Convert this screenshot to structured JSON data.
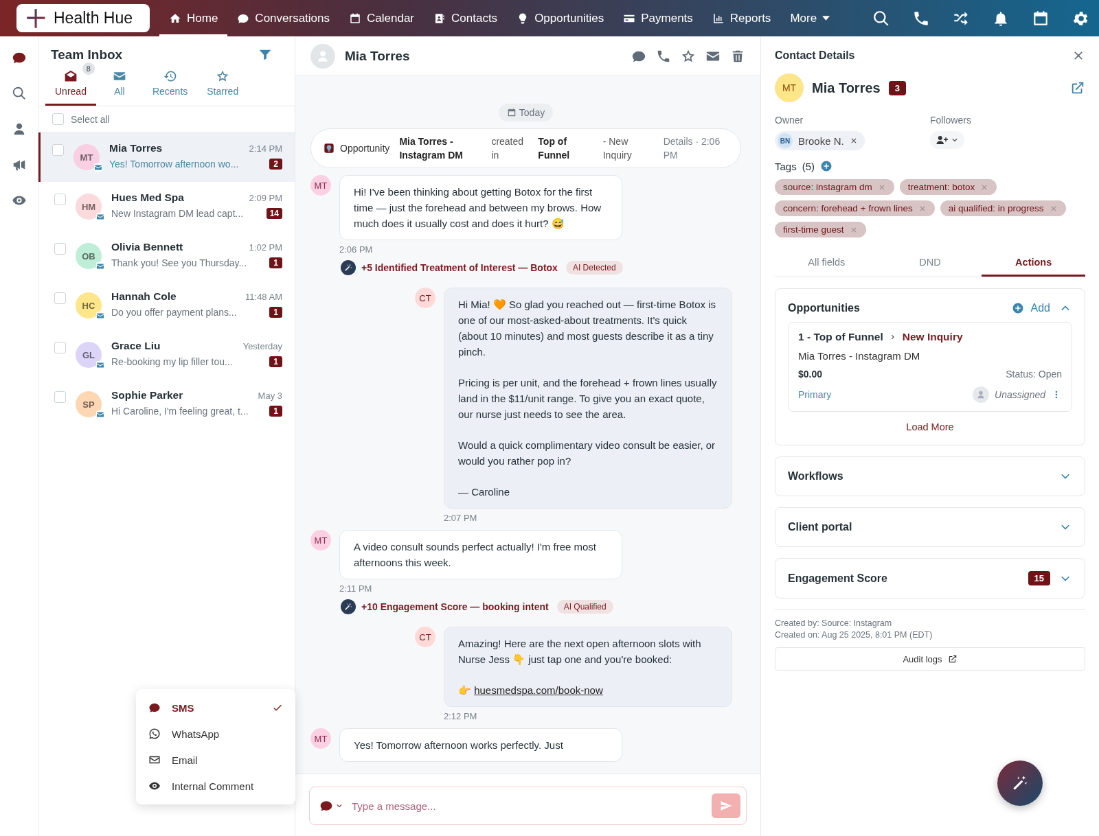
{
  "top_nav": {
    "logo": "Health Hue",
    "items": [
      {
        "label": "Home",
        "selected": true
      },
      {
        "label": "Conversations",
        "selected": false
      },
      {
        "label": "Calendar",
        "selected": false
      },
      {
        "label": "Contacts",
        "selected": false
      },
      {
        "label": "Opportunities",
        "selected": false
      },
      {
        "label": "Payments",
        "selected": false
      },
      {
        "label": "Reports",
        "selected": false
      }
    ],
    "more": "More"
  },
  "rail": [
    {
      "selected": true
    },
    {
      "selected": false
    },
    {
      "selected": false
    },
    {
      "selected": false
    },
    {
      "selected": false
    }
  ],
  "inbox": {
    "title": "Team Inbox",
    "tabs": [
      {
        "label": "Unread",
        "badge": "8",
        "selected": true
      },
      {
        "label": "All",
        "selected": false
      },
      {
        "label": "Recents",
        "selected": false
      },
      {
        "label": "Starred",
        "selected": false
      }
    ],
    "select_all": {
      "label": "Select all",
      "checked": false
    },
    "conversations": [
      {
        "initials": "MT",
        "name": "Mia Torres",
        "preview": "Yes! Tomorrow afternoon wo...",
        "time": "2:14 PM",
        "count": "2",
        "color": "#f9cfe3",
        "checked": false,
        "selected": true
      },
      {
        "initials": "HM",
        "name": "Hues Med Spa",
        "preview": "New Instagram DM lead capt...",
        "time": "2:09 PM",
        "count": "14",
        "color": "#fbdadd",
        "checked": false,
        "selected": false
      },
      {
        "initials": "OB",
        "name": "Olivia Bennett",
        "preview": "Thank you! See you Thursday...",
        "time": "1:02 PM",
        "count": "1",
        "color": "#bfeed8",
        "checked": false,
        "selected": false
      },
      {
        "initials": "HC",
        "name": "Hannah Cole",
        "preview": "Do you offer payment plans...",
        "time": "11:48 AM",
        "count": "1",
        "color": "#fde68a",
        "checked": false,
        "selected": false
      },
      {
        "initials": "GL",
        "name": "Grace Liu",
        "preview": "Re-booking my lip filler tou...",
        "time": "Yesterday",
        "count": "1",
        "color": "#ddd5f8",
        "checked": false,
        "selected": false
      },
      {
        "initials": "SP",
        "name": "Sophie Parker",
        "preview": "Hi Caroline, I'm feeling great, t...",
        "time": "May 3",
        "count": "1",
        "color": "#fdd7b4",
        "checked": false,
        "selected": false
      }
    ]
  },
  "channel_menu": [
    {
      "label": "SMS",
      "selected": true
    },
    {
      "label": "WhatsApp",
      "selected": false
    },
    {
      "label": "Email",
      "selected": false
    },
    {
      "label": "Internal Comment",
      "selected": false
    }
  ],
  "chat": {
    "contact": "Mia Torres",
    "date_chip": "Today",
    "messages": [
      {
        "kind": "opportunity",
        "parts": [
          {
            "text": "Opportunity",
            "kind": "label"
          },
          {
            "text": "Mia Torres - Instagram DM",
            "kind": "strong"
          },
          {
            "text": "created in",
            "kind": "plain"
          },
          {
            "text": "Top of Funnel",
            "kind": "strong"
          },
          {
            "text": "- New Inquiry",
            "kind": "plain"
          },
          {
            "text": "Details · 2:06 PM",
            "kind": "meta"
          }
        ]
      },
      {
        "kind": "incoming",
        "initials": "MT",
        "paragraphs": [
          "Hi! I've been thinking about getting Botox for the first time — just the forehead and between my brows. How much does it usually cost and does it hurt? 😅"
        ],
        "time": "2:06 PM"
      },
      {
        "kind": "score",
        "text": "+5 Identified Treatment of Interest — Botox",
        "tag": "AI Detected"
      },
      {
        "kind": "outgoing",
        "initials": "CT",
        "paragraphs": [
          "Hi Mia! 🧡 So glad you reached out — first-time Botox is one of our most-asked-about treatments. It's quick (about 10 minutes) and most guests describe it as a tiny pinch.",
          "Pricing is per unit, and the forehead + frown lines usually land in the $11/unit range. To give you an exact quote, our nurse just needs to see the area.",
          "Would a quick complimentary video consult be easier, or would you rather pop in?",
          "— Caroline"
        ],
        "time": "2:07 PM"
      },
      {
        "kind": "incoming",
        "initials": "MT",
        "paragraphs": [
          "A video consult sounds perfect actually! I'm free most afternoons this week."
        ],
        "time": "2:11 PM"
      },
      {
        "kind": "score",
        "text": "+10 Engagement Score — booking intent",
        "tag": "AI Qualified"
      },
      {
        "kind": "outgoing",
        "initials": "CT",
        "paragraphs": [
          "Amazing! Here are the next open afternoon slots with Nurse Jess 👇 just tap one and you're booked:"
        ],
        "link": {
          "emoji": "👉",
          "text": "huesmedspa.com/book-now"
        },
        "time": "2:12 PM"
      },
      {
        "kind": "incoming",
        "initials": "MT",
        "paragraphs": [
          "Yes! Tomorrow afternoon works perfectly. Just"
        ]
      }
    ],
    "composer": {
      "placeholder": "Type a message..."
    }
  },
  "contact_panel": {
    "title": "Contact Details",
    "initials": "MT",
    "name": "Mia Torres",
    "badge": "3",
    "owner_label": "Owner",
    "owner": {
      "initials": "BN",
      "name": "Brooke N."
    },
    "followers_label": "Followers",
    "tags_label": "Tags",
    "tags_count": "(5)",
    "tags": [
      "source: instagram dm",
      "treatment: botox",
      "concern: forehead + frown lines",
      "ai qualified: in progress",
      "first-time guest"
    ],
    "tabs": [
      {
        "label": "All fields",
        "selected": false
      },
      {
        "label": "DND",
        "selected": false
      },
      {
        "label": "Actions",
        "selected": true
      }
    ],
    "sections": [
      {
        "title": "Opportunities",
        "expanded": true,
        "add": "Add",
        "card": {
          "pipeline": "1 - Top of Funnel",
          "stage": "New Inquiry",
          "name": "Mia Torres - Instagram DM",
          "amount": "$0.00",
          "status": "Status: Open",
          "tag": "Primary",
          "assignee": "Unassigned"
        },
        "load_more": "Load More"
      },
      {
        "title": "Workflows",
        "expanded": false
      },
      {
        "title": "Client portal",
        "expanded": false
      },
      {
        "title": "Engagement Score",
        "expanded": false,
        "badge": "15"
      }
    ],
    "created_by": "Created by: Source: Instagram",
    "created_on": "Created on: Aug 25 2025, 8:01 PM (EDT)",
    "audit": "Audit logs"
  }
}
